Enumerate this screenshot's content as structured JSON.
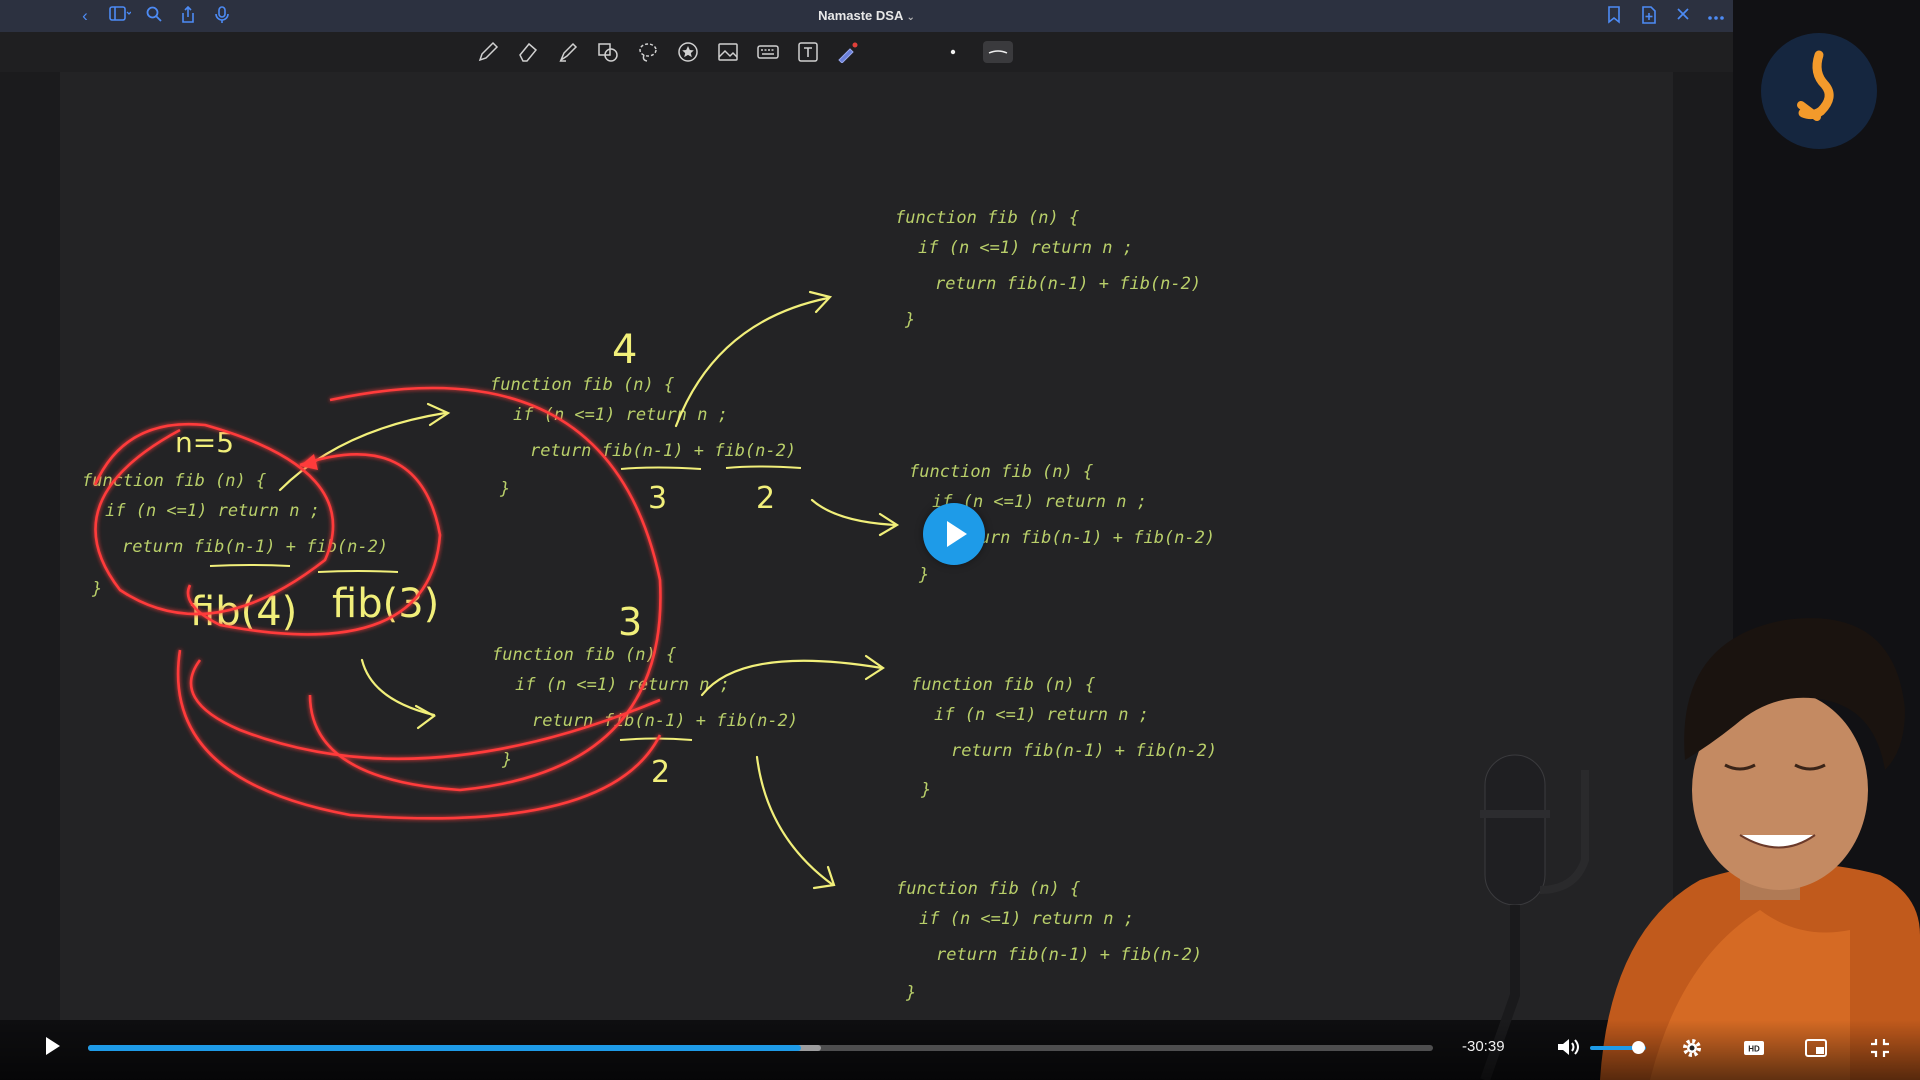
{
  "document": {
    "title": "Namaste DSA",
    "title_chevron": "⌄"
  },
  "titlebar_icons": [
    "back-icon",
    "sidebar-icon",
    "search-icon",
    "share-icon",
    "microphone-icon",
    "bookmark-icon",
    "add-page-icon",
    "close-icon",
    "more-icon"
  ],
  "toolbar_tools": [
    "pen-icon",
    "eraser-icon",
    "highlighter-icon",
    "shapes-icon",
    "lasso-icon",
    "sticker-icon",
    "image-icon",
    "keyboard-icon",
    "text-box-icon",
    "laser-pointer-icon",
    "dot-size-icon",
    "line-style-icon"
  ],
  "notes": {
    "code_line1": "function fib (n) {",
    "code_line2": "if (n <=1)  return n ;",
    "code_line3": "return   fib(n-1) + fib(n-2)",
    "code_close": "}",
    "n_label": "n=5",
    "fib4": "fib(4)",
    "fib3": "fib(3)",
    "num_4": "4",
    "num_3": "3",
    "num_2": "2"
  },
  "player": {
    "time_remaining": "-30:39",
    "progress_played": 0.53,
    "progress_buffered": 0.545,
    "volume": 0.85,
    "accent_color": "#1e9be8"
  },
  "controls_icons": [
    "play-icon",
    "volume-icon",
    "settings-icon",
    "hd-icon",
    "picture-in-picture-icon",
    "exit-fullscreen-icon"
  ]
}
